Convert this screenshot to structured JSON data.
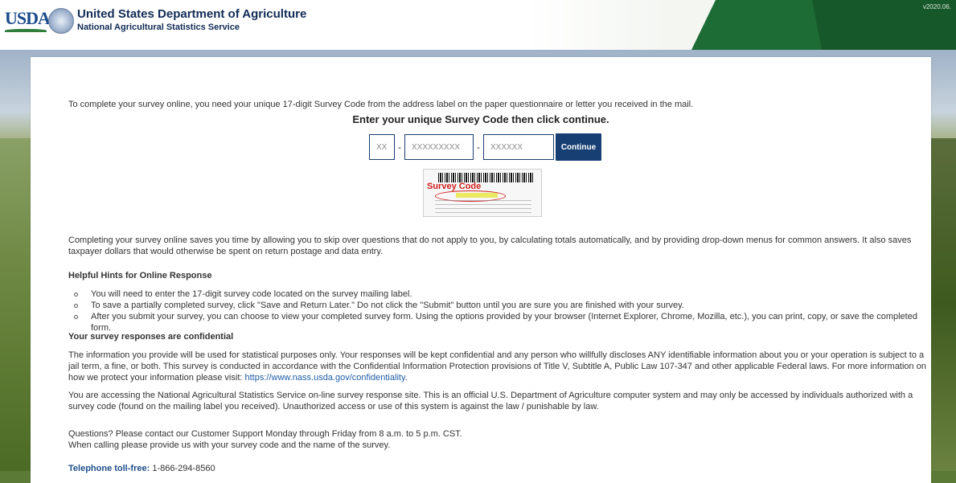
{
  "header": {
    "logo_text": "USDA",
    "agency_name": "United States Department of Agriculture",
    "service_name": "National Agricultural Statistics Service",
    "version": "v2020.06.",
    "accent_color": "#1d6b35"
  },
  "main": {
    "intro": "To complete your survey online, you need your unique 17-digit Survey Code from the address label on the paper questionnaire or letter you received in the mail.",
    "instruction": "Enter your unique Survey Code then click continue.",
    "code_inputs": {
      "part1_placeholder": "XX",
      "part2_placeholder": "XXXXXXXXX",
      "part3_placeholder": "XXXXXX",
      "separator": "-"
    },
    "continue_label": "Continue",
    "label_image_caption": "Survey Code",
    "benefits": "Completing your survey online saves you time by allowing you to skip over questions that do not apply to you, by calculating totals automatically, and by providing drop-down menus for common answers. It also saves taxpayer dollars that would otherwise be spent on return postage and data entry.",
    "hints_heading": "Helpful Hints for Online Response",
    "hints": [
      "You will need to enter the 17-digit survey code located on the survey mailing label.",
      "To save a partially completed survey, click \"Save and Return Later.\" Do not click the \"Submit\" button until you are sure you are finished with your survey.",
      "After you submit your survey, you can choose to view your completed survey form. Using the options provided by your browser (Internet Explorer, Chrome, Mozilla, etc.), you can print, copy, or save the completed form."
    ],
    "confidential_heading": "Your survey responses are confidential",
    "confidential_text": "The information you provide will be used for statistical purposes only. Your responses will be kept confidential and any person who willfully discloses ANY identifiable information about you or your operation is subject to a jail term, a fine, or both. This survey is conducted in accordance with the Confidential Information Protection provisions of Title V, Subtitle A, Public Law 107-347 and other applicable Federal laws. For more information on how we protect your information please visit:",
    "confidential_link": "https://www.nass.usda.gov/confidentiality",
    "access_text": "You are accessing the National Agricultural Statistics Service on-line survey response site. This is an official U.S. Department of Agriculture computer system and may only be accessed by individuals authorized with a survey code (found on the mailing label you received). Unauthorized access or use of this system is against the law / punishable by law.",
    "questions_line1": "Questions? Please contact our Customer Support Monday through Friday from 8 a.m. to 5 p.m. CST.",
    "questions_line2": "When calling please provide us with your survey code and the name of the survey.",
    "phone_label": "Telephone toll-free:",
    "phone_number": "1-866-294-8560"
  }
}
